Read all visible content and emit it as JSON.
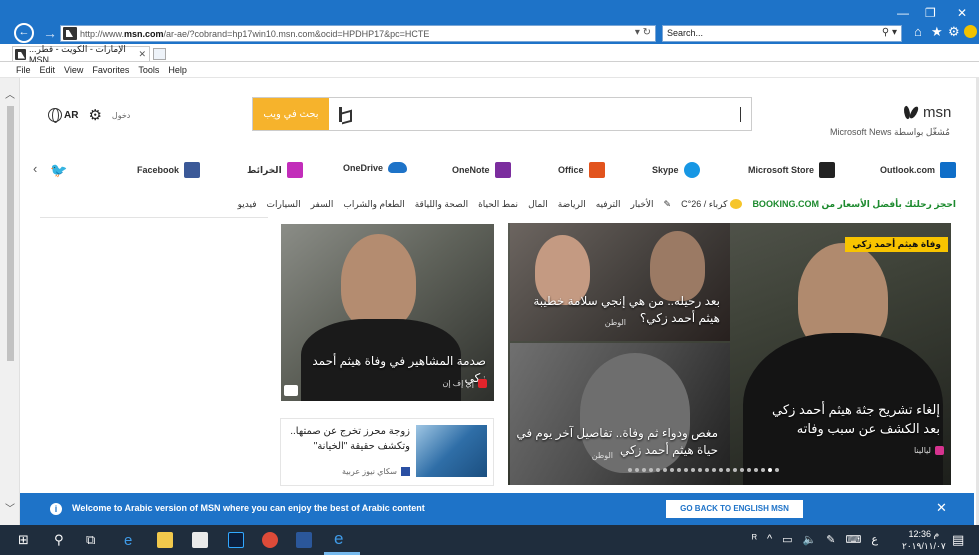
{
  "browser": {
    "url_prefix": "http://www.",
    "url_domain": "msn.com",
    "url_rest": "/ar-ae/?cobrand=hp17win10.msn.com&ocid=HPDHP17&pc=HCTE",
    "search_placeholder": "Search...",
    "tab_title": "...الإمارات - الكويت - قطر MSN",
    "menu": [
      "File",
      "Edit",
      "View",
      "Favorites",
      "Tools",
      "Help"
    ]
  },
  "header": {
    "lang": "AR",
    "signin": "دخول",
    "search_button": "بحث في ويب",
    "brand": "msn",
    "powered_by": "مُشغّل بواسطة Microsoft News"
  },
  "quick_links": {
    "outlook": "Outlook.com",
    "store": "Microsoft Store",
    "skype": "Skype",
    "office": "Office",
    "onenote": "OneNote",
    "onedrive": "OneDrive",
    "maps": "الخرائط",
    "facebook": "Facebook"
  },
  "categories": {
    "booking": "احجز رحلتك بأفضل الأسعار من BOOKING.COM",
    "weather": "كرباء / 26°C",
    "items": [
      "الأخبار",
      "الترفيه",
      "الرياضة",
      "المال",
      "نمط الحياة",
      "الصحة واللياقة",
      "الطعام والشراب",
      "السفر",
      "السيارات",
      "فيديو"
    ]
  },
  "tiles": {
    "hero_badge": "وفاة هيثم أحمد زكي",
    "hero_caption": "إلغاء تشريح جثة هيثم أحمد زكي بعد الكشف عن سبب وفاته",
    "hero_source": "ليالينا",
    "tile_a_caption": "بعد رحيله.. من هي إنجي سلامة خطيبة هيثم أحمد زكي؟",
    "tile_a_source": "الوطن",
    "tile_b_caption": "مغص ودواء ثم وفاة.. تفاصيل آخر يوم في حياة هيثم أحمد زكي",
    "tile_b_source": "الوطن",
    "tile_c_caption": "صدمة المشاهير في وفاة هيثم أحمد زكي",
    "tile_c_source": "إي إف إن",
    "small_title": "زوجة محرز تخرج عن صمتها.. وتكشف حقيقة \"الخيانة\"",
    "small_source": "سكاي نيوز عربية"
  },
  "notification": {
    "message": "Welcome to Arabic version of MSN where you can enjoy the best of Arabic content",
    "button": "GO BACK TO ENGLISH MSN"
  },
  "taskbar": {
    "time": "12:36 م",
    "date": "٢٠١٩/١١/٠٧",
    "input_lang": "ع"
  },
  "colors": {
    "ie_blue": "#1e73c8",
    "search_orange": "#f6b32c",
    "badge_yellow": "#f8c400",
    "booking_green": "#1c8a2e",
    "taskbar": "#1f2d3d"
  }
}
